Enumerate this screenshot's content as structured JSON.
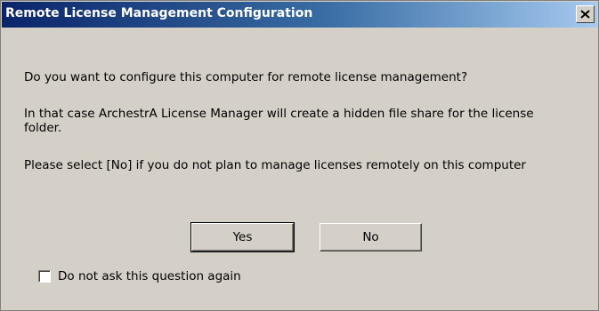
{
  "window": {
    "title": "Remote License Management Configuration"
  },
  "titlebar": {
    "close_glyph": "✕",
    "close_icon": "close-icon"
  },
  "message": {
    "question": "Do you want to configure this computer for remote license management?",
    "detail": "In that case ArchestrA License Manager will create a hidden file share for the license folder.",
    "hint": "Please select [No] if you do not plan to manage licenses remotely on this computer"
  },
  "buttons": {
    "yes_label": "Yes",
    "no_label": "No"
  },
  "checkbox": {
    "label": "Do not ask this question again",
    "checked": false
  },
  "colors": {
    "dialog_background": "#d4d0c8",
    "titlebar_start": "#0a246a",
    "titlebar_end": "#a6caf0"
  }
}
